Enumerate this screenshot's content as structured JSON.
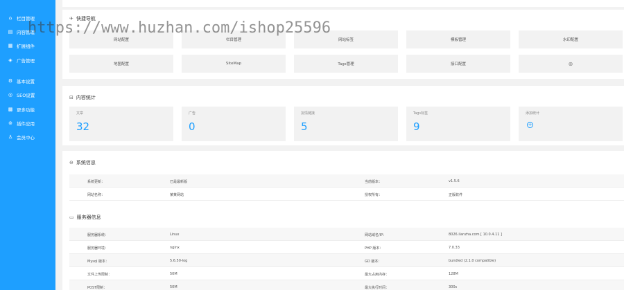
{
  "sidebar": {
    "items": [
      {
        "icon": "home-icon",
        "glyph": "⌂",
        "label": "栏目管理"
      },
      {
        "icon": "document-icon",
        "glyph": "▤",
        "label": "内容管理"
      },
      {
        "icon": "extension-icon",
        "glyph": "▦",
        "label": "扩展组件"
      },
      {
        "icon": "ad-icon",
        "glyph": "◈",
        "label": "广告管理"
      },
      {
        "icon": "gear-icon",
        "glyph": "⚙",
        "label": "基本设置"
      },
      {
        "icon": "seo-icon",
        "glyph": "◎",
        "label": "SEO设置"
      },
      {
        "icon": "grid-icon",
        "glyph": "▩",
        "label": "更多功能"
      },
      {
        "icon": "plugin-icon",
        "glyph": "⊚",
        "label": "插件应用"
      },
      {
        "icon": "user-icon",
        "glyph": "♙",
        "label": "会员中心"
      }
    ]
  },
  "watermark": "https://www.huzhan.com/ishop25596",
  "quick_nav": {
    "title": "快捷导航",
    "row1": [
      "网站配置",
      "栏目管理",
      "网站标签",
      "模板管理",
      "水印配置"
    ],
    "row2": [
      "地图配置",
      "SiteMap",
      "Tags管理",
      "接口配置",
      "⊕"
    ]
  },
  "content_stats": {
    "title": "内容统计",
    "items": [
      {
        "label": "文章",
        "value": "32"
      },
      {
        "label": "广告",
        "value": "0"
      },
      {
        "label": "友情链接",
        "value": "5"
      },
      {
        "label": "Tags标签",
        "value": "9"
      },
      {
        "label": "添加统计",
        "value": ""
      }
    ]
  },
  "system_info": {
    "title": "系统信息",
    "rows": [
      {
        "k1": "系统更新：",
        "v1": "已是最新版",
        "k2": "当前版本：",
        "v2": "v1.5.6"
      },
      {
        "k1": "网站名称：",
        "v1": "某某网站",
        "k2": "授权所有：",
        "v2": "正版软件"
      }
    ]
  },
  "server_info": {
    "title": "服务器信息",
    "rows": [
      {
        "k1": "服务器系统：",
        "v1": "Linux",
        "k2": "网站域名/IP：",
        "v2": "8026.ilanzha.com [ 10.0.4.11 ]"
      },
      {
        "k1": "服务器环境：",
        "v1": "nginx",
        "k2": "PHP 版本：",
        "v2": "7.0.33"
      },
      {
        "k1": "Mysql 版本：",
        "v1": "5.6.50-log",
        "k2": "GD 版本：",
        "v2": "bundled (2.1.0 compatible)"
      },
      {
        "k1": "文件上传限制：",
        "v1": "50M",
        "k2": "最大占用内存：",
        "v2": "128M"
      },
      {
        "k1": "POST限制：",
        "v1": "50M",
        "k2": "最大执行时间：",
        "v2": "300s"
      }
    ]
  }
}
